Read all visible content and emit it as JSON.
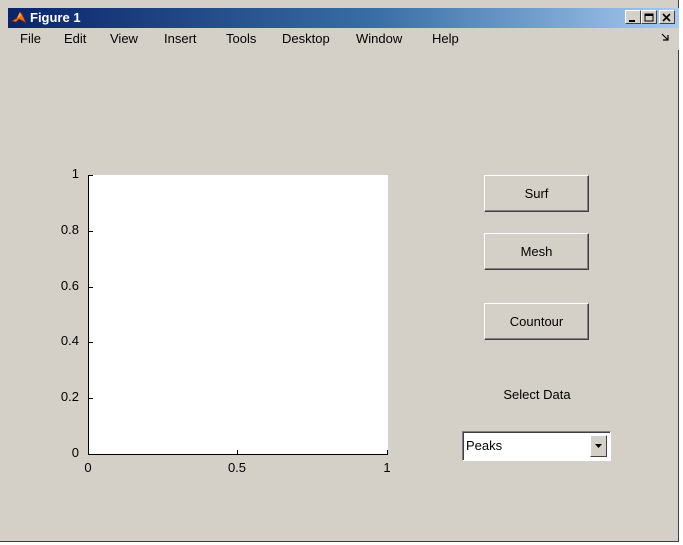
{
  "window": {
    "title": "Figure 1",
    "controls": [
      "minimize",
      "maximize",
      "close"
    ]
  },
  "menubar": {
    "items": [
      "File",
      "Edit",
      "View",
      "Insert",
      "Tools",
      "Desktop",
      "Window",
      "Help"
    ]
  },
  "axes": {
    "x_ticks": [
      "0",
      "0.5",
      "1"
    ],
    "y_ticks": [
      "0",
      "0.2",
      "0.4",
      "0.6",
      "0.8",
      "1"
    ],
    "xlim": [
      0,
      1
    ],
    "ylim": [
      0,
      1
    ]
  },
  "buttons": {
    "surf": "Surf",
    "mesh": "Mesh",
    "contour": "Countour"
  },
  "select": {
    "label": "Select Data",
    "value": "Peaks"
  },
  "colors": {
    "window_bg": "#d4d0c8",
    "title_gradient_start": "#0a246a",
    "title_gradient_end": "#a6caf0",
    "axes_bg": "#ffffff"
  }
}
